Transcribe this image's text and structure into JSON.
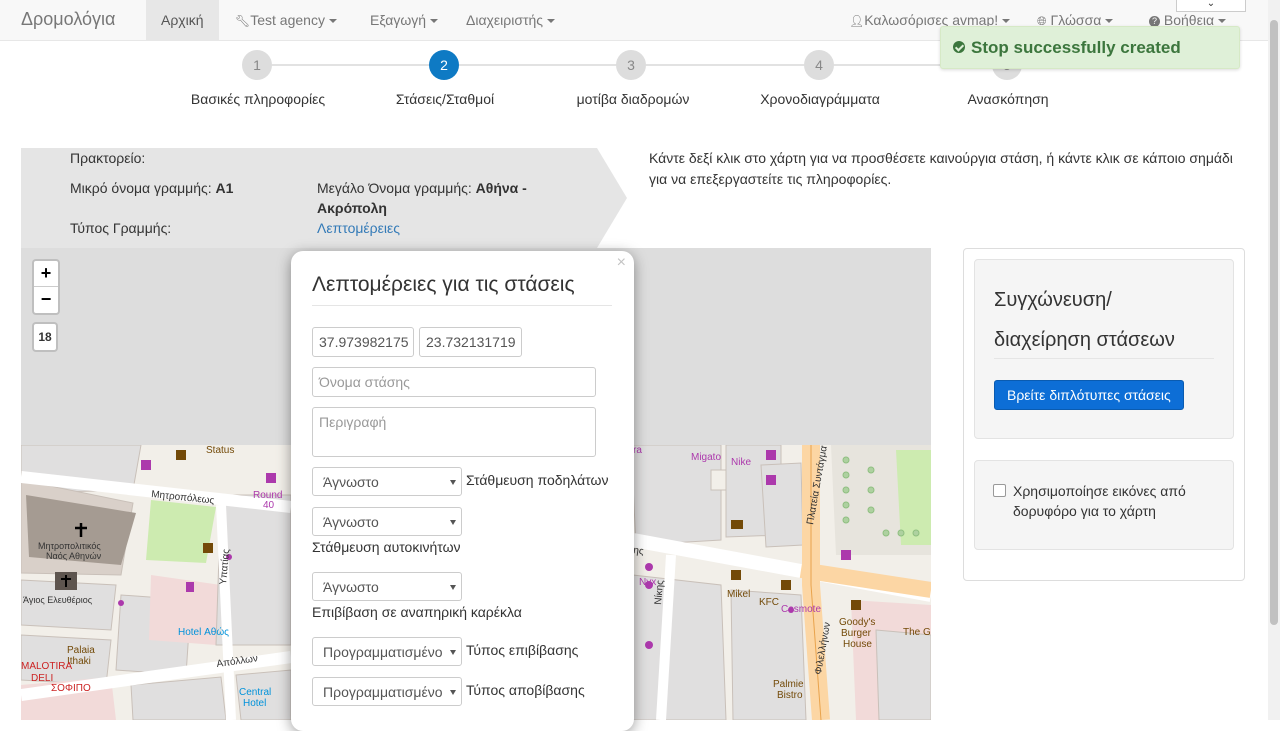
{
  "navbar": {
    "brand": "Δρομολόγια",
    "items": [
      {
        "label": "Αρχική"
      },
      {
        "label": "Test agency"
      },
      {
        "label": "Εξαγωγή"
      },
      {
        "label": "Διαχειριστής"
      },
      {
        "label": "Καλωσόρισες avmap!"
      },
      {
        "label": "Γλώσσα"
      },
      {
        "label": "Βοήθεια"
      }
    ]
  },
  "toast": {
    "message": "Stop successfully created"
  },
  "wizard": {
    "steps": [
      {
        "number": "1",
        "label": "Βασικές πληροφορίες"
      },
      {
        "number": "2",
        "label": "Στάσεις/Σταθμοί"
      },
      {
        "number": "3",
        "label": "μοτίβα διαδρομών"
      },
      {
        "number": "4",
        "label": "Χρονοδιαγράμματα"
      },
      {
        "number": "5",
        "label": "Ανασκόπηση"
      }
    ],
    "active_step": 2
  },
  "route_info": {
    "agency_label": "Πρακτορείο:",
    "short_name_label": "Μικρό όνομα γραμμής:",
    "short_name_value": "A1",
    "long_name_label": "Μεγάλο Όνομα γραμμής:",
    "long_name_value_1": "Αθήνα -",
    "long_name_value_2": "Ακρόπολη",
    "type_label": "Τύπος Γραμμής:",
    "details_link": "Λεπτομέρειες"
  },
  "hint": "Κάντε δεξί κλικ στο χάρτη για να προσθέσετε καινούργια στάση, ή κάντε κλικ σε κάποιο σημάδι για να επεξεργαστείτε τις πληροφορίες.",
  "map": {
    "zoom_in": "+",
    "zoom_out": "−",
    "zoom_level": "18",
    "labels": [
      "Μητροπόλεως",
      "Μητροπολιτικός Ναός Αθηνών",
      "Άγιος Ελευθέριος",
      "Status",
      "Round 40",
      "Hotel Αθώς",
      "Palaia Ithaki",
      "MALOTIRA DELI",
      "ΣΟΦΙΠΟ",
      "Απόλλων",
      "Central Hotel",
      "Υπατίας",
      "Migato",
      "Nike",
      "Nyx",
      "Mikel",
      "KFC",
      "Cosmote",
      "Νίκης",
      "Goody's Burger House",
      "The G",
      "Palmie Bistro",
      "Πλατεία Συντάγματος",
      "Φιλελλήνων",
      "ra",
      "ης"
    ]
  },
  "stop_popup": {
    "title": "Λεπτομέρειες για τις στάσεις",
    "close": "×",
    "lat": "37.973982175",
    "lon": "23.732131719",
    "name_placeholder": "Όνομα στάσης",
    "description_placeholder": "Περιγραφή",
    "bike_parking": {
      "value": "Άγνωστο",
      "label": "Στάθμευση ποδηλάτων"
    },
    "car_parking": {
      "value": "Άγνωστο",
      "label": "Στάθμευση αυτοκινήτων"
    },
    "wheelchair": {
      "value": "Άγνωστο",
      "label": "Επιβίβαση σε αναπηρική καρέκλα"
    },
    "pickup": {
      "value": "Προγραμματισμένο",
      "label": "Τύπος επιβίβασης"
    },
    "dropoff": {
      "value": "Προγραμματισμένο",
      "label": "Τύπος αποβίβασης"
    }
  },
  "side": {
    "merge_title_1": "Συγχώνευση/",
    "merge_title_2": "διαχείρηση στάσεων",
    "find_duplicates": "Βρείτε διπλότυπες στάσεις",
    "satellite_label": "Χρησιμοποίησε εικόνες από δορυφόρο για το χάρτη"
  },
  "colors": {
    "primary": "#0e7ac4",
    "success_bg": "#dff0d8",
    "success_text": "#3c763d",
    "button": "#0d6ed6"
  }
}
